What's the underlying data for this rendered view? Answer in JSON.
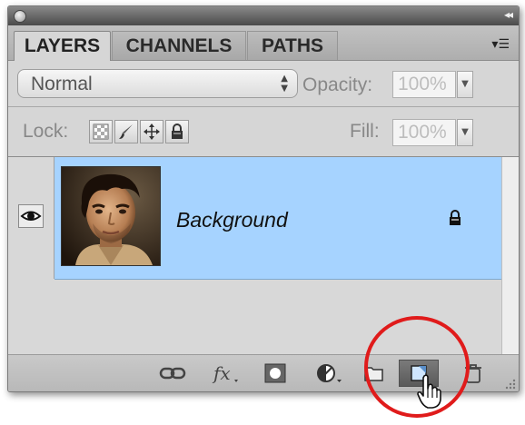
{
  "panel": {
    "tabs": [
      {
        "label": "LAYERS",
        "active": true
      },
      {
        "label": "CHANNELS",
        "active": false
      },
      {
        "label": "PATHS",
        "active": false
      }
    ]
  },
  "blend_mode": {
    "value": "Normal"
  },
  "opacity": {
    "label": "Opacity:",
    "value": "100%"
  },
  "lock": {
    "label": "Lock:"
  },
  "fill": {
    "label": "Fill:",
    "value": "100%"
  },
  "layers": [
    {
      "name": "Background",
      "visible": true,
      "selected": true,
      "locked": true
    }
  ],
  "colors": {
    "selection": "#a6d3ff",
    "annotation_circle": "#e01b1b"
  },
  "icons": {
    "titlebar": [
      "close-icon",
      "collapse-icon"
    ],
    "lock_buttons": [
      "lock-transparent-pixels-icon",
      "lock-image-pixels-icon",
      "lock-position-icon",
      "lock-all-icon"
    ],
    "bottom_bar": [
      "link-layers-icon",
      "layer-style-fx-icon",
      "add-mask-icon",
      "adjustment-layer-icon",
      "new-group-icon",
      "new-layer-icon",
      "trash-icon"
    ]
  }
}
